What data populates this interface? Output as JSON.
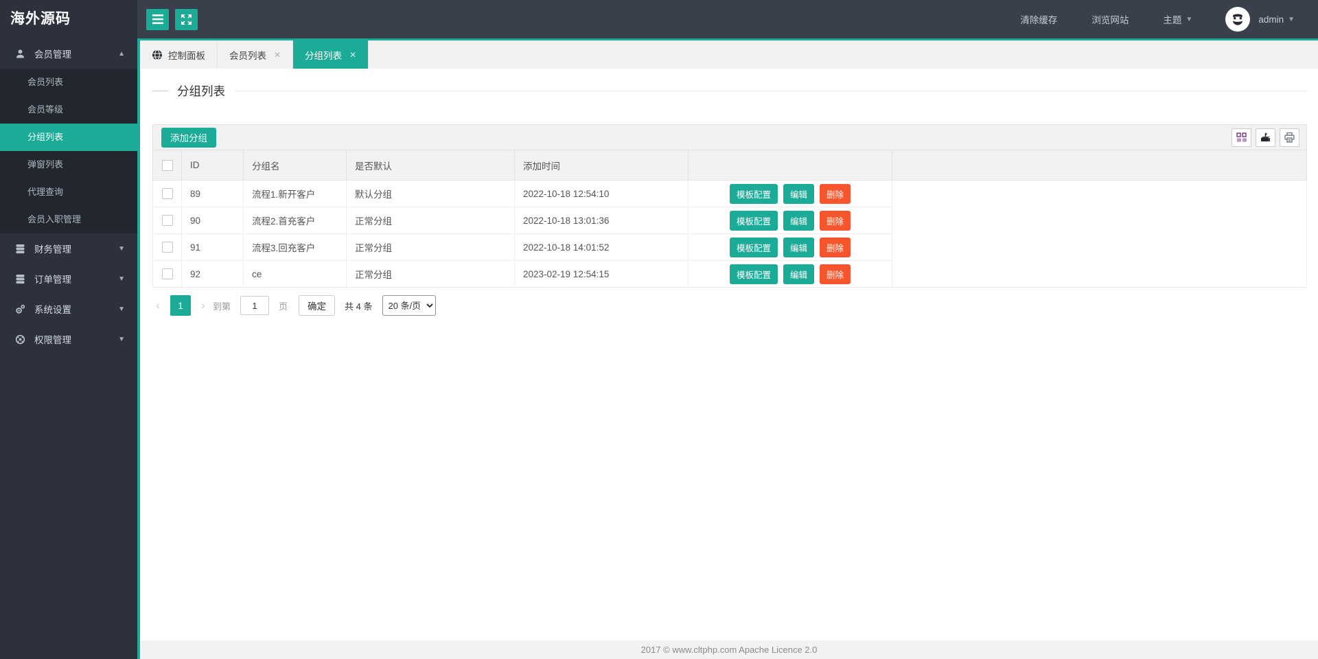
{
  "colors": {
    "accent": "#1bab97",
    "danger": "#f7552d",
    "header_bg": "#3a404b",
    "sidebar_bg": "#2c313c",
    "submenu_bg": "#22262e"
  },
  "brand": {
    "logo_text": "海外源码"
  },
  "header": {
    "nav": [
      {
        "label": "清除缓存",
        "caret": false
      },
      {
        "label": "浏览网站",
        "caret": false
      },
      {
        "label": "主题",
        "caret": true
      }
    ],
    "user": {
      "name": "admin"
    }
  },
  "sidebar": {
    "items": [
      {
        "label": "会员管理",
        "icon": "user",
        "expanded": true,
        "children": [
          {
            "label": "会员列表",
            "active": false
          },
          {
            "label": "会员等级",
            "active": false
          },
          {
            "label": "分组列表",
            "active": true
          },
          {
            "label": "弹窗列表",
            "active": false
          },
          {
            "label": "代理查询",
            "active": false
          },
          {
            "label": "会员入职管理",
            "active": false
          }
        ]
      },
      {
        "label": "财务管理",
        "icon": "database",
        "expanded": false
      },
      {
        "label": "订单管理",
        "icon": "database",
        "expanded": false
      },
      {
        "label": "系统设置",
        "icon": "gears",
        "expanded": false
      },
      {
        "label": "权限管理",
        "icon": "globe",
        "expanded": false
      }
    ]
  },
  "tabs": [
    {
      "label": "控制面板",
      "icon": "globe-tab",
      "closable": false,
      "active": false
    },
    {
      "label": "会员列表",
      "icon": null,
      "closable": true,
      "active": false
    },
    {
      "label": "分组列表",
      "icon": null,
      "closable": true,
      "active": true
    }
  ],
  "page": {
    "title": "分组列表"
  },
  "panel": {
    "add_button": "添加分组",
    "tools": [
      {
        "icon": "columns"
      },
      {
        "icon": "export"
      },
      {
        "icon": "print"
      }
    ]
  },
  "table": {
    "columns": [
      "ID",
      "分组名",
      "是否默认",
      "添加时间"
    ],
    "rows": [
      {
        "id": "89",
        "name": "流程1.新开客户",
        "default": "默认分组",
        "time": "2022-10-18 12:54:10"
      },
      {
        "id": "90",
        "name": "流程2.首充客户",
        "default": "正常分组",
        "time": "2022-10-18 13:01:36"
      },
      {
        "id": "91",
        "name": "流程3.回充客户",
        "default": "正常分组",
        "time": "2022-10-18 14:01:52"
      },
      {
        "id": "92",
        "name": "ce",
        "default": "正常分组",
        "time": "2023-02-19 12:54:15"
      }
    ],
    "row_actions": [
      {
        "label": "模板配置",
        "style": "primary"
      },
      {
        "label": "编辑",
        "style": "primary"
      },
      {
        "label": "删除",
        "style": "danger"
      }
    ]
  },
  "pagination": {
    "prev": "‹",
    "next": "›",
    "current": "1",
    "goto_label": "到第",
    "page_input_value": "1",
    "page_unit": "页",
    "confirm_label": "确定",
    "total_label": "共 4 条",
    "page_size_label": "20 条/页"
  },
  "footer": {
    "text": "2017 ©  www.cltphp.com  Apache Licence 2.0"
  }
}
